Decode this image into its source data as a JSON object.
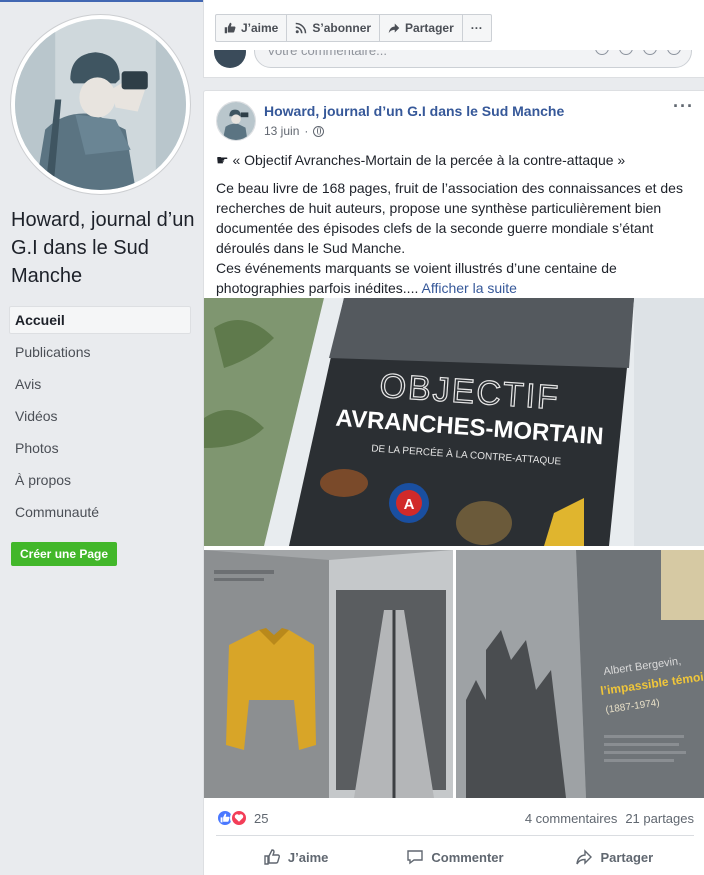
{
  "sidebar": {
    "page_name": "Howard, journal d’un G.I dans le Sud Manche",
    "nav": [
      "Accueil",
      "Publications",
      "Avis",
      "Vidéos",
      "Photos",
      "À propos",
      "Communauté"
    ],
    "create_page": "Créer une Page"
  },
  "top_card": {
    "like": "J’aime",
    "subscribe": "S’abonner",
    "share": "Partager",
    "more": "···",
    "comment_placeholder": "Votre commentaire..."
  },
  "post": {
    "author": "Howard, journal d’un G.I dans le Sud Manche",
    "date": "13 juin",
    "dot": "·",
    "more": "···",
    "headline": "☛ « Objectif Avranches-Mortain de la percée à la contre-attaque »",
    "body1": "Ce beau livre de 168 pages, fruit de l’association des connaissances et des recherches de huit auteurs, propose une synthèse particulièrement bien documentée des épisodes clefs de la seconde guerre mondiale s’étant déroulés dans le Sud Manche.",
    "body2": "Ces événements marquants se voient illustrés d’une centaine de photographies parfois inédites....",
    "see_more": "Afficher la suite",
    "book_title_1": "OBJECTIF",
    "book_title_2": "AVRANCHES-MORTAIN",
    "book_subtitle": "DE LA PERCÉE À LA CONTRE-ATTAQUE",
    "inner_page_name": "Albert Bergevin,",
    "inner_page_title": "l’impassible témoin",
    "inner_page_years": "(1887-1974)",
    "reaction_count": "25",
    "comments": "4 commentaires",
    "shares": "21 partages",
    "actions": {
      "like": "J’aime",
      "comment": "Commenter",
      "share": "Partager"
    }
  },
  "colors": {
    "brand_blue": "#4267b2",
    "link": "#365899",
    "green": "#42b72a",
    "background": "#e9ebee"
  }
}
